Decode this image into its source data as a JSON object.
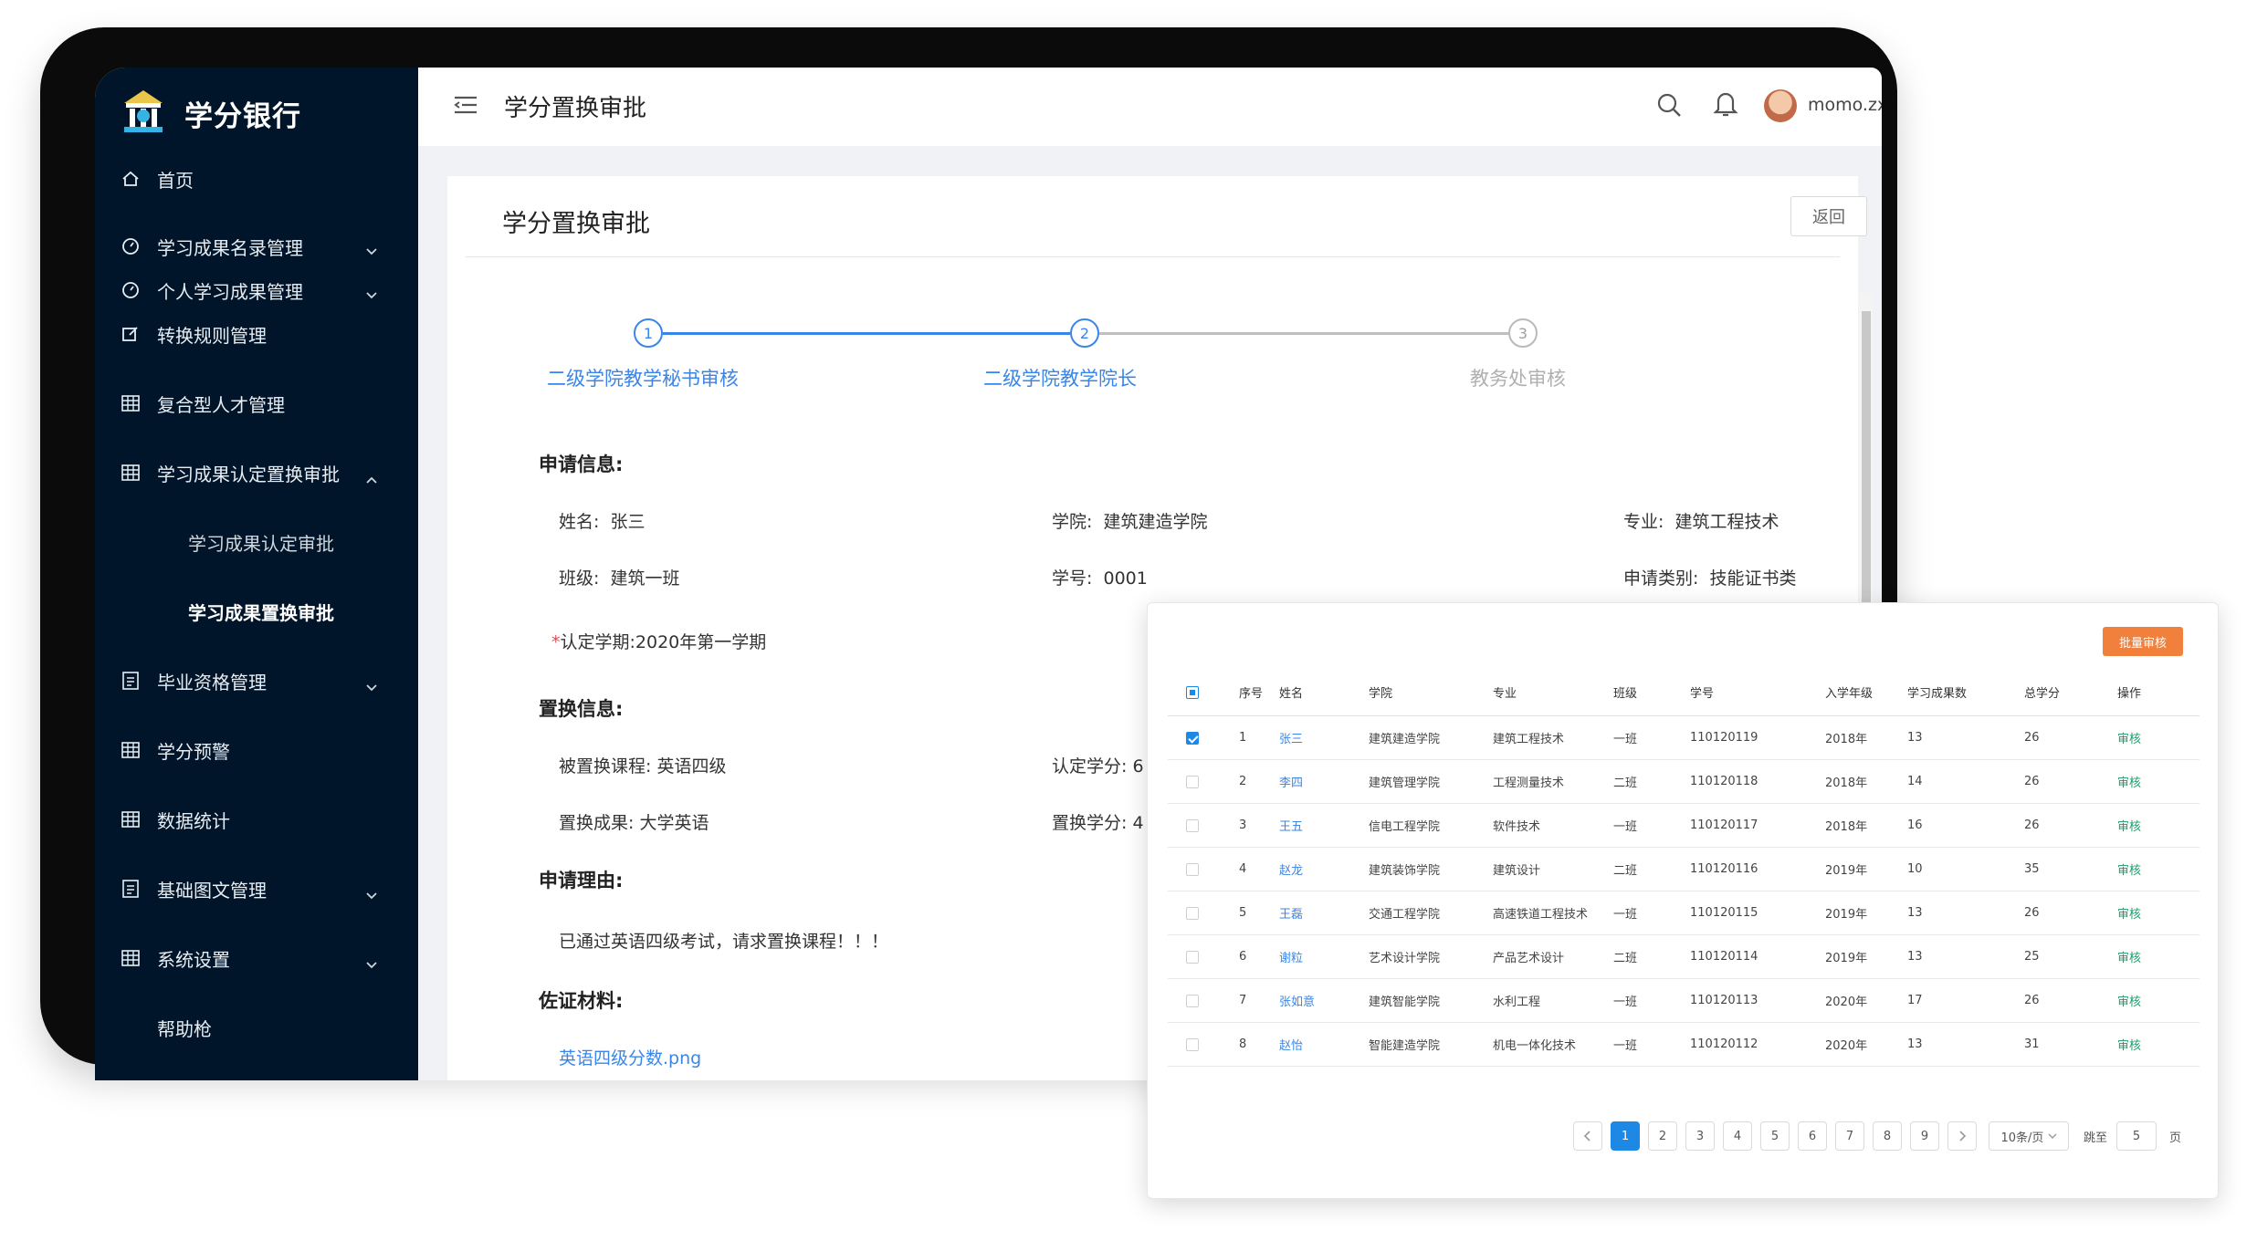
{
  "app": {
    "logo_text": "学分银行",
    "page_title": "学分置换审批",
    "username": "momo.zxy"
  },
  "sidebar": {
    "items": [
      {
        "label": "首页",
        "icon": "home-icon"
      },
      {
        "label": "学习成果名录管理",
        "icon": "gauge-icon",
        "chevron": "down"
      },
      {
        "label": "个人学习成果管理",
        "icon": "gauge-icon",
        "chevron": "down"
      },
      {
        "label": "转换规则管理",
        "icon": "edit-icon"
      },
      {
        "label": "复合型人才管理",
        "icon": "table-icon"
      },
      {
        "label": "学习成果认定置换审批",
        "icon": "table-icon",
        "chevron": "up"
      },
      {
        "label": "学习成果认定审批",
        "sub": true
      },
      {
        "label": "学习成果置换审批",
        "sub": true,
        "active": true
      },
      {
        "label": "毕业资格管理",
        "icon": "list-icon",
        "chevron": "down"
      },
      {
        "label": "学分预警",
        "icon": "table-icon"
      },
      {
        "label": "数据统计",
        "icon": "table-icon"
      },
      {
        "label": "基础图文管理",
        "icon": "list-icon",
        "chevron": "down"
      },
      {
        "label": "系统设置",
        "icon": "table-icon",
        "chevron": "down"
      },
      {
        "label": "帮助枪",
        "icon": "none"
      }
    ]
  },
  "card": {
    "title": "学分置换审批",
    "back_label": "返回"
  },
  "steps": [
    {
      "num": "1",
      "label": "二级学院教学秘书审核",
      "status": "done"
    },
    {
      "num": "2",
      "label": "二级学院教学院长",
      "status": "done"
    },
    {
      "num": "3",
      "label": "教务处审核",
      "status": "todo"
    }
  ],
  "apply_info": {
    "section": "申请信息:",
    "name_label": "姓名:",
    "name": "张三",
    "college_label": "学院:",
    "college": "建筑建造学院",
    "major_label": "专业:",
    "major": "建筑工程技术",
    "class_label": "班级:",
    "class": "建筑一班",
    "id_label": "学号:",
    "id": "0001",
    "type_label": "申请类别:",
    "type": "技能证书类",
    "term_req": "*",
    "term_label": "认定学期:",
    "term": "2020年第一学期"
  },
  "replace_info": {
    "section": "置换信息:",
    "course_label": "被置换课程:",
    "course": "英语四级",
    "credit_label": "认定学分:",
    "credit": "6",
    "result_label": "置换成果:",
    "result": "大学英语",
    "rcredit_label": "置换学分:",
    "rcredit": "4"
  },
  "reason": {
    "section": "申请理由:",
    "text": "已通过英语四级考试，请求置换课程！！！"
  },
  "evidence": {
    "section": "佐证材料:",
    "file": "英语四级分数.png"
  },
  "panel": {
    "batch_label": "批量审核",
    "headers": [
      "序号",
      "姓名",
      "学院",
      "专业",
      "班级",
      "学号",
      "入学年级",
      "学习成果数",
      "总学分",
      "操作"
    ],
    "rows": [
      {
        "no": "1",
        "name": "张三",
        "college": "建筑建造学院",
        "major": "建筑工程技术",
        "cls": "一班",
        "sid": "110120119",
        "year": "2018年",
        "count": "13",
        "credit": "26",
        "op": "审核",
        "checked": true
      },
      {
        "no": "2",
        "name": "李四",
        "college": "建筑管理学院",
        "major": "工程测量技术",
        "cls": "二班",
        "sid": "110120118",
        "year": "2018年",
        "count": "14",
        "credit": "26",
        "op": "审核",
        "checked": false
      },
      {
        "no": "3",
        "name": "王五",
        "college": "信电工程学院",
        "major": "软件技术",
        "cls": "一班",
        "sid": "110120117",
        "year": "2018年",
        "count": "16",
        "credit": "26",
        "op": "审核",
        "checked": false
      },
      {
        "no": "4",
        "name": "赵龙",
        "college": "建筑装饰学院",
        "major": "建筑设计",
        "cls": "二班",
        "sid": "110120116",
        "year": "2019年",
        "count": "10",
        "credit": "35",
        "op": "审核",
        "checked": false
      },
      {
        "no": "5",
        "name": "王磊",
        "college": "交通工程学院",
        "major": "高速铁道工程技术",
        "cls": "一班",
        "sid": "110120115",
        "year": "2019年",
        "count": "13",
        "credit": "26",
        "op": "审核",
        "checked": false
      },
      {
        "no": "6",
        "name": "谢粒",
        "college": "艺术设计学院",
        "major": "产品艺术设计",
        "cls": "二班",
        "sid": "110120114",
        "year": "2019年",
        "count": "13",
        "credit": "25",
        "op": "审核",
        "checked": false
      },
      {
        "no": "7",
        "name": "张如意",
        "college": "建筑智能学院",
        "major": "水利工程",
        "cls": "一班",
        "sid": "110120113",
        "year": "2020年",
        "count": "17",
        "credit": "26",
        "op": "审核",
        "checked": false
      },
      {
        "no": "8",
        "name": "赵怡",
        "college": "智能建造学院",
        "major": "机电一体化技术",
        "cls": "一班",
        "sid": "110120112",
        "year": "2020年",
        "count": "13",
        "credit": "31",
        "op": "审核",
        "checked": false
      }
    ],
    "pagination": {
      "pages": [
        "1",
        "2",
        "3",
        "4",
        "5",
        "6",
        "7",
        "8",
        "9"
      ],
      "current": "1",
      "page_size": "10条/页",
      "jump_label": "跳至",
      "jump_value": "5",
      "page_suffix": "页"
    }
  },
  "colors": {
    "sidebar_bg": "#001529",
    "primary": "#3a86e8",
    "batch_orange": "#f0803c",
    "op_green": "#1aa06b"
  }
}
